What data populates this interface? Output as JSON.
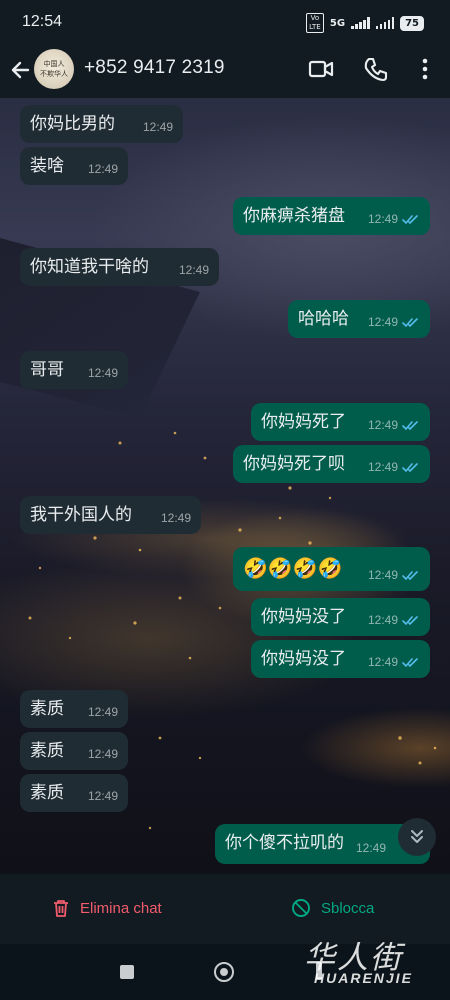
{
  "status_bar": {
    "time": "12:54",
    "network_badge": "Vo LTE",
    "network_type": "5G",
    "battery": "75"
  },
  "header": {
    "contact": "+852 9417 2319",
    "avatar_text": "中国人 不欺华人"
  },
  "messages": [
    {
      "dir": "in",
      "text": "你妈比男的",
      "time": "12:49"
    },
    {
      "dir": "in",
      "text": "装啥",
      "time": "12:49"
    },
    {
      "dir": "out",
      "text": "你麻痹杀猪盘",
      "time": "12:49"
    },
    {
      "dir": "in",
      "text": "你知道我干啥的",
      "time": "12:49"
    },
    {
      "dir": "out",
      "text": "哈哈哈",
      "time": "12:49"
    },
    {
      "dir": "in",
      "text": "哥哥",
      "time": "12:49"
    },
    {
      "dir": "out",
      "text": "你妈妈死了",
      "time": "12:49"
    },
    {
      "dir": "out",
      "text": "你妈妈死了呗",
      "time": "12:49"
    },
    {
      "dir": "in",
      "text": "我干外国人的",
      "time": "12:49"
    },
    {
      "dir": "out",
      "text": "🤣🤣🤣🤣",
      "time": "12:49"
    },
    {
      "dir": "out",
      "text": "你妈妈没了",
      "time": "12:49"
    },
    {
      "dir": "out",
      "text": "你妈妈没了",
      "time": "12:49"
    },
    {
      "dir": "in",
      "text": "素质",
      "time": "12:49"
    },
    {
      "dir": "in",
      "text": "素质",
      "time": "12:49"
    },
    {
      "dir": "in",
      "text": "素质",
      "time": "12:49"
    },
    {
      "dir": "out",
      "text": "你个傻不拉叽的",
      "time": "12:49"
    }
  ],
  "bottom_actions": {
    "delete_label": "Elimina chat",
    "unblock_label": "Sblocca"
  },
  "watermark": {
    "cn": "华人街",
    "en": "HUARENJIE"
  },
  "colors": {
    "incoming_bubble": "#202c33",
    "outgoing_bubble": "#005c4b",
    "read_ticks": "#53bdeb",
    "delete": "#f15c6d",
    "unblock": "#00a884"
  },
  "icons": [
    "back-arrow-icon",
    "video-call-icon",
    "phone-icon",
    "more-vert-icon",
    "double-check-icon",
    "scroll-down-icon",
    "trash-icon",
    "unblock-icon"
  ]
}
